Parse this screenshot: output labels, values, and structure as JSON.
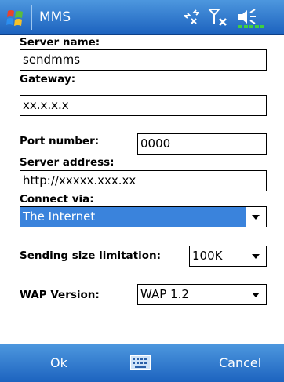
{
  "titlebar": {
    "title": "MMS",
    "start_icon": "windows-flag-icon",
    "status_icons": [
      "connectivity-icon",
      "signal-strength-icon",
      "volume-icon"
    ]
  },
  "form": {
    "server_name": {
      "label": "Server name:",
      "value": "sendmms"
    },
    "gateway": {
      "label": "Gateway:",
      "value": "xx.x.x.x"
    },
    "port_number": {
      "label": "Port number:",
      "value": "0000"
    },
    "server_address": {
      "label": "Server address:",
      "value": "http://xxxxx.xxx.xx"
    },
    "connect_via": {
      "label": "Connect via:",
      "value": "The Internet"
    },
    "sending_size": {
      "label": "Sending size limitation:",
      "value": "100K"
    },
    "wap_version": {
      "label": "WAP Version:",
      "value": "WAP 1.2"
    }
  },
  "softkeys": {
    "left": "Ok",
    "right": "Cancel",
    "center_icon": "keyboard-icon"
  },
  "colors": {
    "bar_blue": "#2a72cc",
    "highlight": "#3a83dc"
  }
}
